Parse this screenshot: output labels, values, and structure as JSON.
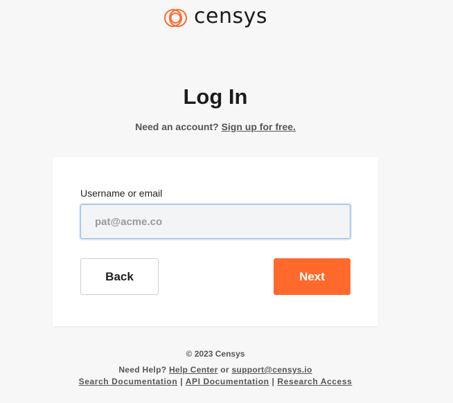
{
  "brand": {
    "name": "censys",
    "accent_color": "#ff6a2c",
    "logo_icon": "censys-rings-logo-icon"
  },
  "login": {
    "title": "Log In",
    "signup_prompt": "Need an account?",
    "signup_link": "Sign up for free."
  },
  "form": {
    "username_label": "Username or email",
    "username_placeholder": "pat@acme.co",
    "back_label": "Back",
    "next_label": "Next"
  },
  "footer": {
    "copyright": "© 2023 Censys",
    "help_prompt": "Need Help?",
    "help_center": "Help Center",
    "or": "or",
    "support_email": "support@censys.io",
    "search_docs": "Search Documentation",
    "separator": "|",
    "api_docs": "API Documentation",
    "research_access": "Research Access"
  }
}
